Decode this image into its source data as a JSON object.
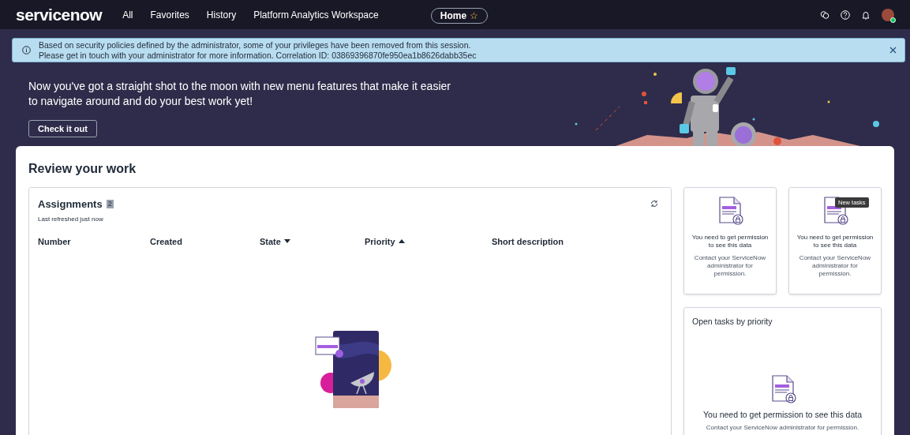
{
  "nav": {
    "logo": "servicenow",
    "menu": [
      {
        "label": "All"
      },
      {
        "label": "Favorites"
      },
      {
        "label": "History"
      },
      {
        "label": "Platform Analytics Workspace"
      }
    ],
    "home_tab": {
      "label": "Home",
      "star": "☆"
    }
  },
  "banner": {
    "lines": [
      "Based on security policies defined by the administrator, some of your privileges have been removed from this session.",
      "Please get in touch with your administrator for more information. Correlation ID: 03869396870fe950ea1b8626dabb35ec"
    ]
  },
  "hero": {
    "text": "Now you've got a straight shot to the moon with new menu features that make it easier to navigate around and do your best work yet!",
    "button": "Check it out"
  },
  "review": {
    "title": "Review your work",
    "assignments": {
      "title": "Assignments",
      "count": "2",
      "subtitle": "Last refreshed just now",
      "columns": [
        {
          "label": "Number"
        },
        {
          "label": "Created"
        },
        {
          "label": "State",
          "sort_ascending": false
        },
        {
          "label": "Priority",
          "sort_ascending": true
        },
        {
          "label": "Short description"
        }
      ]
    },
    "permission_cards": [
      {
        "title": "You need to get permission to see this data",
        "text": "Contact your ServiceNow administrator for permission."
      },
      {
        "title": "You need to get permission to see this data",
        "text": "Contact your ServiceNow administrator for permission.",
        "tooltip": "New tasks"
      }
    ],
    "open_tasks": {
      "title": "Open tasks by priority",
      "message": "You need to get permission to see this data",
      "detail": "Contact your ServiceNow administrator for permission."
    }
  }
}
